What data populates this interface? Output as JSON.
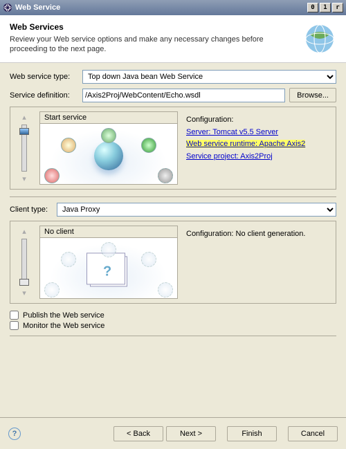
{
  "titlebar": {
    "title": "Web Service"
  },
  "banner": {
    "heading": "Web Services",
    "subheading": "Review your Web service options and make any necessary changes before proceeding to the next page."
  },
  "fields": {
    "ws_type_label": "Web service type:",
    "ws_type_value": "Top down Java bean Web Service",
    "svc_def_label": "Service definition:",
    "svc_def_value": "/Axis2Proj/WebContent/Echo.wsdl",
    "browse": "Browse..."
  },
  "service_panel": {
    "graphic_title": "Start service",
    "config_heading": "Configuration:",
    "link_server": "Server: Tomcat v5.5 Server",
    "link_runtime": "Web service runtime: Apache Axis2",
    "link_project": "Service project: Axis2Proj"
  },
  "client": {
    "label": "Client type:",
    "value": "Java Proxy",
    "graphic_title": "No client",
    "config_text": "Configuration: No client generation."
  },
  "checks": {
    "publish": "Publish the Web service",
    "monitor": "Monitor the Web service"
  },
  "footer": {
    "back": "< Back",
    "next": "Next >",
    "finish": "Finish",
    "cancel": "Cancel"
  }
}
